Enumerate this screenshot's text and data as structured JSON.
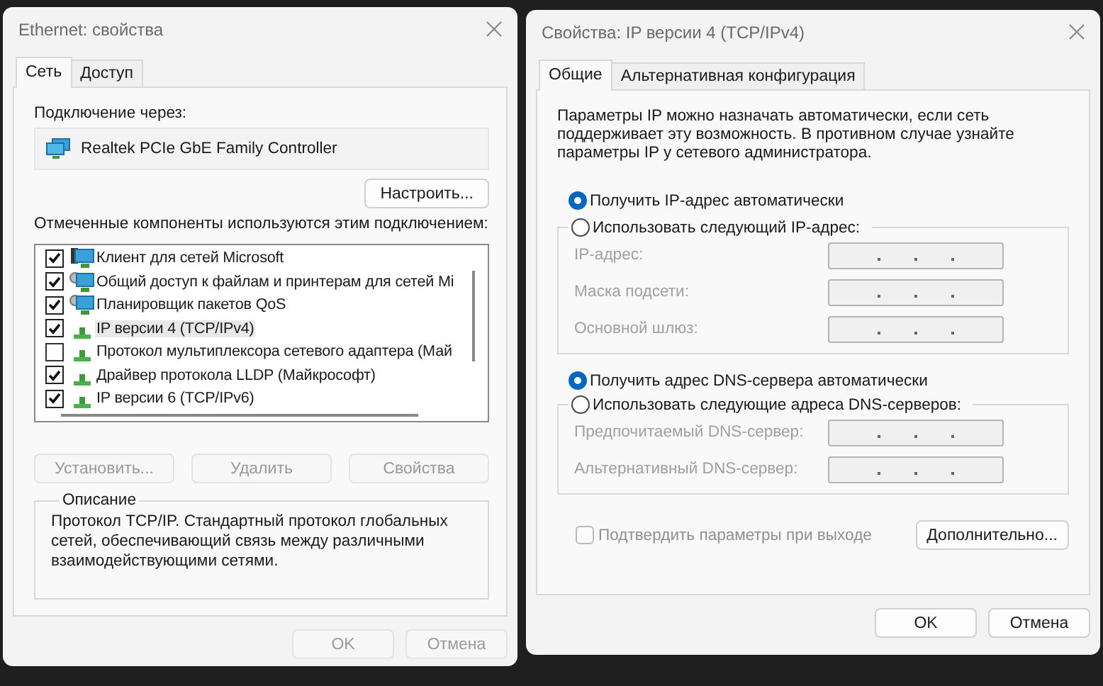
{
  "ethernet_window": {
    "title": "Ethernet: свойства",
    "tabs": [
      {
        "label": "Сеть",
        "selected": true
      },
      {
        "label": "Доступ",
        "selected": false
      }
    ],
    "connect_label": "Подключение через:",
    "adapter": "Realtek PCIe GbE Family Controller",
    "configure_button": "Настроить...",
    "components_label": "Отмеченные компоненты используются этим подключением:",
    "components": [
      {
        "label": "Клиент для сетей Microsoft",
        "checked": true,
        "selected": false,
        "kind": "client"
      },
      {
        "label": "Общий доступ к файлам и принтерам для сетей Mi",
        "checked": true,
        "selected": false,
        "kind": "service"
      },
      {
        "label": "Планировщик пакетов QoS",
        "checked": true,
        "selected": false,
        "kind": "service"
      },
      {
        "label": "IP версии 4 (TCP/IPv4)",
        "checked": true,
        "selected": true,
        "kind": "protocol"
      },
      {
        "label": "Протокол мультиплексора сетевого адаптера (Май",
        "checked": false,
        "selected": false,
        "kind": "protocol"
      },
      {
        "label": "Драйвер протокола LLDP (Майкрософт)",
        "checked": true,
        "selected": false,
        "kind": "protocol"
      },
      {
        "label": "IP версии 6 (TCP/IPv6)",
        "checked": true,
        "selected": false,
        "kind": "protocol"
      }
    ],
    "action_buttons": [
      {
        "label": "Установить...",
        "disabled": true
      },
      {
        "label": "Удалить",
        "disabled": true
      },
      {
        "label": "Свойства",
        "disabled": true
      }
    ],
    "description": {
      "title": "Описание",
      "text": "Протокол TCP/IP. Стандартный протокол глобальных сетей, обеспечивающий связь между различными взаимодействующими сетями."
    },
    "buttons": [
      {
        "label": "OK",
        "disabled": true
      },
      {
        "label": "Отмена",
        "disabled": true
      }
    ]
  },
  "ipv4_window": {
    "title": "Свойства: IP версии 4 (TCP/IPv4)",
    "tabs": [
      {
        "label": "Общие",
        "selected": true
      },
      {
        "label": "Альтернативная конфигурация",
        "selected": false
      }
    ],
    "intro": "Параметры IP можно назначать автоматически, если сеть поддерживает эту возможность. В противном случае узнайте параметры IP у сетевого администратора.",
    "ip_options": [
      {
        "label": "Получить IP-адрес автоматически",
        "selected": true
      },
      {
        "label": "Использовать следующий IP-адрес:",
        "selected": false
      }
    ],
    "ip_fields": [
      {
        "label": "IP-адрес:",
        "disabled": true
      },
      {
        "label": "Маска подсети:",
        "disabled": true
      },
      {
        "label": "Основной шлюз:",
        "disabled": true
      }
    ],
    "dns_options": [
      {
        "label": "Получить адрес DNS-сервера автоматически",
        "selected": true
      },
      {
        "label": "Использовать следующие адреса DNS-серверов:",
        "selected": false
      }
    ],
    "dns_fields": [
      {
        "label": "Предпочитаемый DNS-сервер:",
        "disabled": true
      },
      {
        "label": "Альтернативный DNS-сервер:",
        "disabled": true
      }
    ],
    "confirm_checkbox": {
      "label": "Подтвердить параметры при выходе",
      "checked": false,
      "disabled": true
    },
    "advanced_button": "Дополнительно...",
    "buttons": [
      {
        "label": "OK",
        "disabled": false
      },
      {
        "label": "Отмена",
        "disabled": false
      }
    ]
  }
}
